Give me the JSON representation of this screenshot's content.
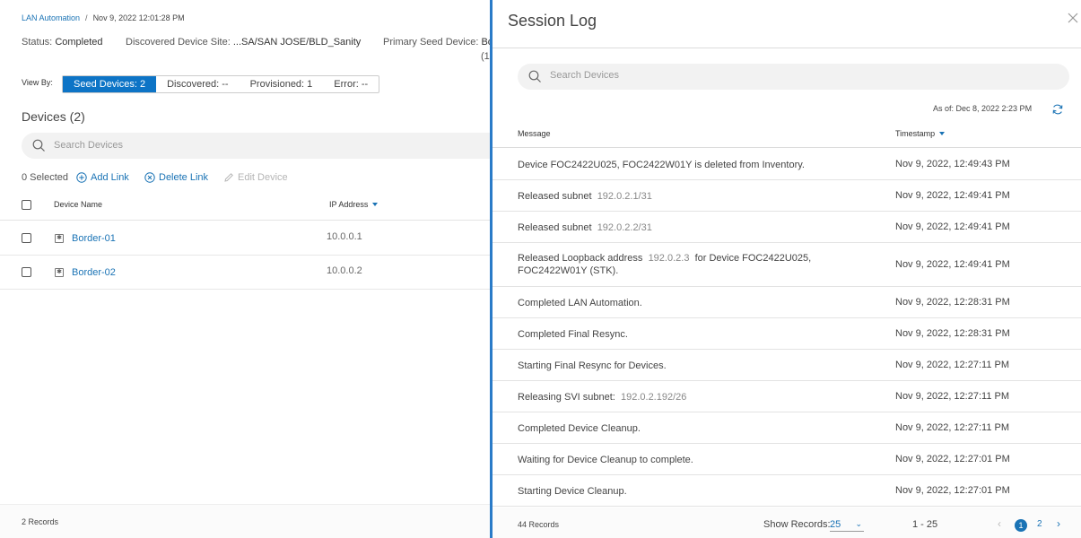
{
  "background_page": {
    "breadcrumb": {
      "link": "LAN Automation",
      "separator": "/",
      "timestamp": "Nov 9, 2022 12:01:28 PM"
    },
    "status": {
      "label": "Status:",
      "value": "Completed"
    },
    "site": {
      "label": "Discovered Device Site:",
      "value": "...SA/SAN JOSE/BLD_Sanity"
    },
    "seed": {
      "label": "Primary Seed Device:",
      "value": "Bo",
      "overflow": "(1"
    },
    "view_by": {
      "label": "View By:",
      "tabs": [
        {
          "label": "Seed Devices: 2",
          "active": true
        },
        {
          "label": "Discovered: --",
          "active": false
        },
        {
          "label": "Provisioned: 1",
          "active": false
        },
        {
          "label": "Error: --",
          "active": false
        }
      ]
    },
    "devices_title": "Devices (2)",
    "search_placeholder": "Search Devices",
    "actions": {
      "selected": "0 Selected",
      "add_link": "Add Link",
      "delete_link": "Delete Link",
      "edit_device": "Edit Device"
    },
    "table": {
      "headers": {
        "device_name": "Device Name",
        "ip_address": "IP Address"
      },
      "rows": [
        {
          "name": "Border-01",
          "ip": "10.0.0.1"
        },
        {
          "name": "Border-02",
          "ip": "10.0.0.2"
        }
      ]
    },
    "footer_records": "2 Records"
  },
  "session_log": {
    "title": "Session Log",
    "search_placeholder": "Search Devices",
    "as_of": "As of: Dec 8, 2022 2:23 PM",
    "headers": {
      "message": "Message",
      "timestamp": "Timestamp"
    },
    "rows": [
      {
        "msg": "Device FOC2422U025, FOC2422W01Y is deleted from Inventory.",
        "ip": "",
        "msg_after": "",
        "ts": "Nov 9, 2022, 12:49:43 PM"
      },
      {
        "msg": "Released subnet",
        "ip": "192.0.2.1/31",
        "msg_after": "",
        "ts": "Nov 9, 2022, 12:49:41 PM"
      },
      {
        "msg": "Released subnet",
        "ip": "192.0.2.2/31",
        "msg_after": "",
        "ts": "Nov 9, 2022, 12:49:41 PM"
      },
      {
        "msg": "Released Loopback address",
        "ip": "192.0.2.3",
        "msg_after": "for Device FOC2422U025, FOC2422W01Y (STK).",
        "ts": "Nov 9, 2022, 12:49:41 PM"
      },
      {
        "msg": "Completed LAN Automation.",
        "ip": "",
        "msg_after": "",
        "ts": "Nov 9, 2022, 12:28:31 PM"
      },
      {
        "msg": "Completed Final Resync.",
        "ip": "",
        "msg_after": "",
        "ts": "Nov 9, 2022, 12:28:31 PM"
      },
      {
        "msg": "Starting Final Resync for Devices.",
        "ip": "",
        "msg_after": "",
        "ts": "Nov 9, 2022, 12:27:11 PM"
      },
      {
        "msg": "Releasing SVI subnet:",
        "ip": "192.0.2.192/26",
        "msg_after": "",
        "ts": "Nov 9, 2022, 12:27:11 PM"
      },
      {
        "msg": "Completed Device Cleanup.",
        "ip": "",
        "msg_after": "",
        "ts": "Nov 9, 2022, 12:27:11 PM"
      },
      {
        "msg": "Waiting for Device Cleanup to complete.",
        "ip": "",
        "msg_after": "",
        "ts": "Nov 9, 2022, 12:27:01 PM"
      },
      {
        "msg": "Starting Device Cleanup.",
        "ip": "",
        "msg_after": "",
        "ts": "Nov 9, 2022, 12:27:01 PM"
      }
    ],
    "footer": {
      "records": "44 Records",
      "show_records_label": "Show Records:",
      "show_records_value": "25",
      "range": "1 - 25",
      "pages": [
        "1",
        "2"
      ],
      "current_page": "1"
    },
    "colors": {
      "accent": "#1a73b5",
      "drawer_border": "#2a7bc8",
      "active_tab": "#0d74c6"
    }
  }
}
